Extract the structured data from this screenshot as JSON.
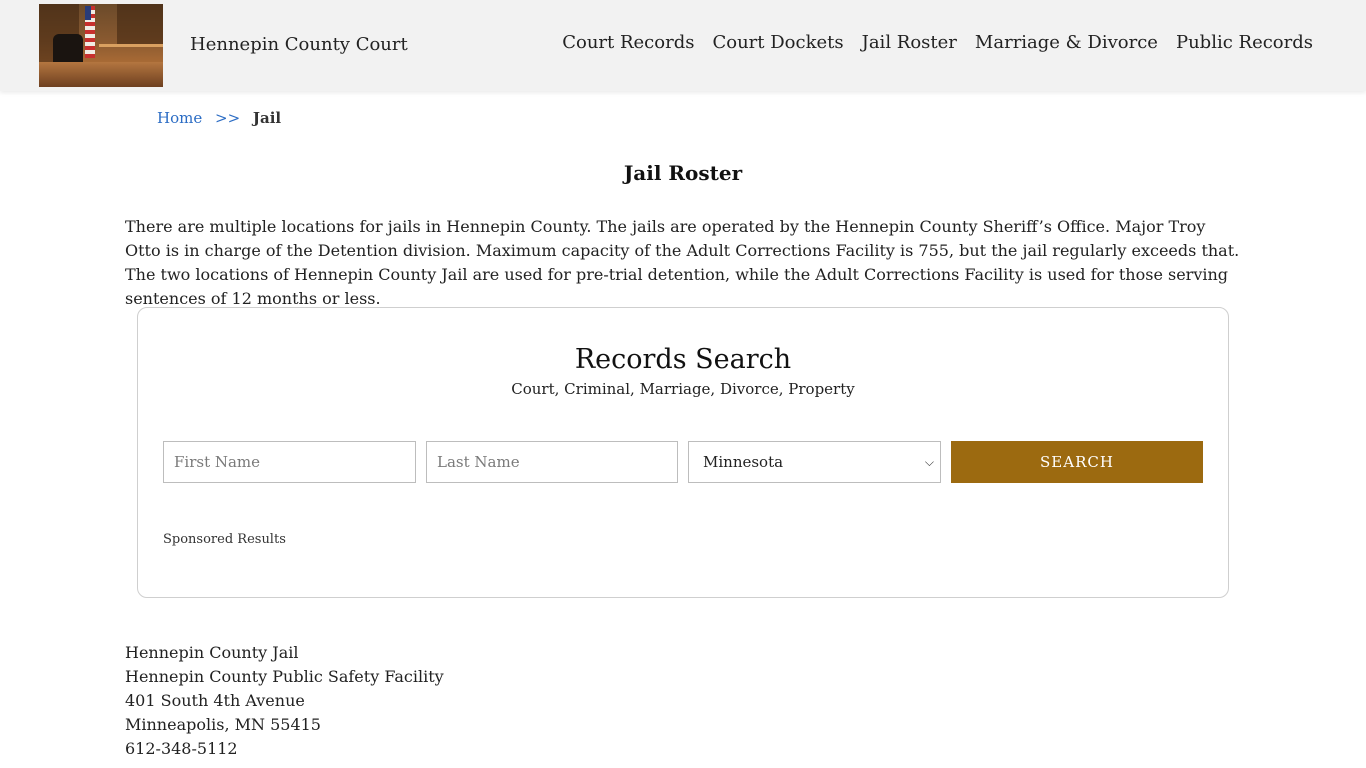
{
  "header": {
    "site_title": "Hennepin County Court",
    "nav": [
      "Court Records",
      "Court Dockets",
      "Jail Roster",
      "Marriage & Divorce",
      "Public Records"
    ]
  },
  "breadcrumb": {
    "home": "Home",
    "separator": ">>",
    "current": "Jail"
  },
  "page": {
    "title": "Jail Roster",
    "intro": "There are multiple locations for jails in Hennepin County. The jails are operated by the Hennepin County Sheriff’s Office. Major Troy Otto is in charge of the Detention division. Maximum capacity of the Adult Corrections Facility is 755, but the jail regularly exceeds that. The two locations of Hennepin County Jail are used for pre-trial detention, while the Adult Corrections Facility is used for those serving sentences of 12 months or less."
  },
  "search": {
    "title": "Records Search",
    "subtitle": "Court, Criminal, Marriage, Divorce, Property",
    "first_name_placeholder": "First Name",
    "last_name_placeholder": "Last Name",
    "state_selected": "Minnesota",
    "button_label": "SEARCH",
    "sponsored_label": "Sponsored Results",
    "button_color": "#9c6a10"
  },
  "address": {
    "lines": [
      "Hennepin County Jail",
      "Hennepin County Public Safety Facility",
      "401 South 4th Avenue",
      "Minneapolis, MN 55415",
      "612-348-5112"
    ]
  }
}
